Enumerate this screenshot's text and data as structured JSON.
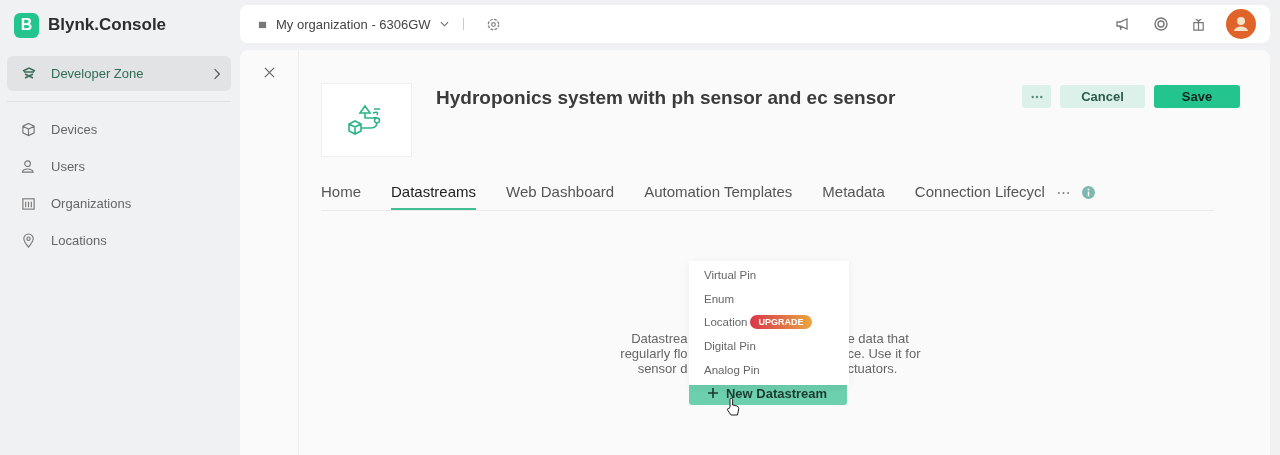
{
  "app": {
    "logo_letter": "B",
    "name": "Blynk.Console"
  },
  "sidebar": {
    "zone": {
      "label": "Developer Zone",
      "selected": true
    },
    "items": [
      {
        "label": "Devices"
      },
      {
        "label": "Users"
      },
      {
        "label": "Organizations"
      },
      {
        "label": "Locations"
      }
    ]
  },
  "topbar": {
    "organization": "My organization - 6306GW"
  },
  "template": {
    "title": "Hydroponics system with ph sensor and ec sensor",
    "buttons": [
      {
        "label": "Cancel",
        "kind": "secondary"
      },
      {
        "label": "Save",
        "kind": "primary"
      }
    ]
  },
  "tabs": [
    {
      "label": "Home",
      "selected": false
    },
    {
      "label": "Datastreams",
      "selected": true
    },
    {
      "label": "Web Dashboard",
      "selected": false
    },
    {
      "label": "Automation Templates",
      "selected": false
    },
    {
      "label": "Metadata",
      "selected": false
    },
    {
      "label": "Connection Lifecycl",
      "selected": false
    }
  ],
  "empty_state": {
    "description_lines": [
      {
        "left": "Datastrea",
        "right": "e data that"
      },
      {
        "left": "regularly flo",
        "right": "ce. Use it for"
      },
      {
        "left": "sensor d",
        "right": "ctuators."
      }
    ],
    "button": "New Datastream"
  },
  "dropdown": [
    {
      "label": "Virtual Pin"
    },
    {
      "label": "Enum"
    },
    {
      "label": "Location",
      "badge": "UPGRADE"
    },
    {
      "label": "Digital Pin"
    },
    {
      "label": "Analog Pin"
    }
  ]
}
